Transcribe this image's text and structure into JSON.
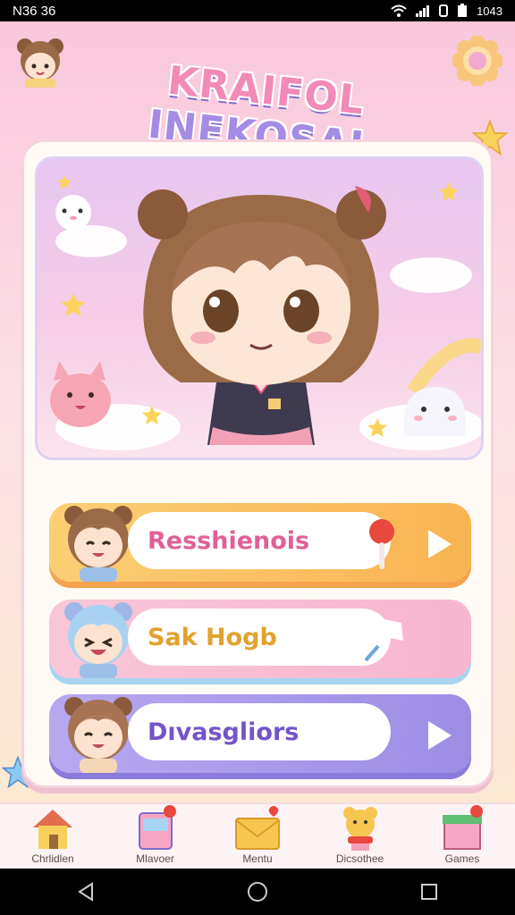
{
  "status": {
    "carrier": "N36 36",
    "time": "1043",
    "icons": [
      "wifi-icon",
      "signal-icon",
      "data-icon",
      "battery-icon"
    ]
  },
  "header": {
    "title_parts": [
      "KRAIFOL ",
      "INEKOSAL"
    ],
    "avatar_icon": "girl-avatar-icon",
    "settings_icon": "flower-gear-icon"
  },
  "menu": [
    {
      "label": "Resshienois",
      "face": "happy-girl-face-icon",
      "deco_icon": "lollipop-icon",
      "color": "#f9b352"
    },
    {
      "label": "Sak Hogb",
      "face": "blue-hair-girl-face-icon",
      "deco_icon": "sparkle-icon",
      "color": "#f7b5cf"
    },
    {
      "label": "Dıvasgliors",
      "face": "winking-girl-face-icon",
      "deco_icon": "play-icon",
      "color": "#9d8de6"
    }
  ],
  "tabs": [
    {
      "label": "Chrlidlen",
      "icon": "house-icon"
    },
    {
      "label": "Mlavoer",
      "icon": "drink-box-icon"
    },
    {
      "label": "Mentu",
      "icon": "envelope-heart-icon"
    },
    {
      "label": "Dicsothee",
      "icon": "bear-scarf-icon"
    },
    {
      "label": "Games",
      "icon": "gift-box-icon"
    }
  ],
  "nav": [
    "back-icon",
    "home-icon",
    "recents-icon"
  ]
}
